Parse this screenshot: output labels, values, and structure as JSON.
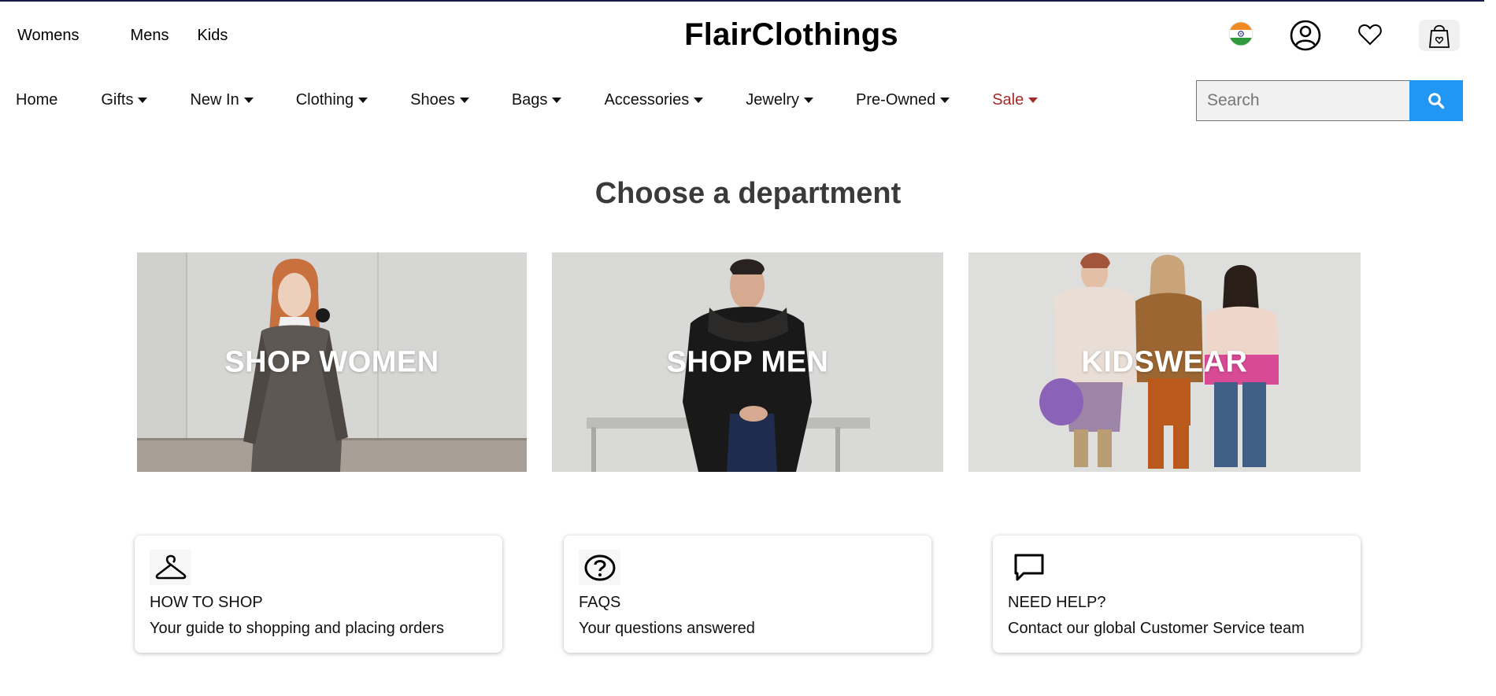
{
  "top_links": [
    "Womens",
    "Mens",
    "Kids"
  ],
  "brand": "FlairClothings",
  "header_icons": [
    "india-flag-icon",
    "account-icon",
    "wishlist-heart-icon",
    "shopping-bag-icon"
  ],
  "nav": {
    "items": [
      {
        "label": "Home",
        "dropdown": false
      },
      {
        "label": "Gifts",
        "dropdown": true
      },
      {
        "label": "New In",
        "dropdown": true
      },
      {
        "label": "Clothing",
        "dropdown": true
      },
      {
        "label": "Shoes",
        "dropdown": true
      },
      {
        "label": "Bags",
        "dropdown": true
      },
      {
        "label": "Accessories",
        "dropdown": true
      },
      {
        "label": "Jewelry",
        "dropdown": true
      },
      {
        "label": "Pre-Owned",
        "dropdown": true
      },
      {
        "label": "Sale",
        "dropdown": true
      }
    ],
    "sale_color": "#a52a2a"
  },
  "search": {
    "placeholder": "Search",
    "value": "",
    "button_color": "#2196f3"
  },
  "heading": "Choose a department",
  "departments": [
    {
      "label": "SHOP WOMEN"
    },
    {
      "label": "SHOP MEN"
    },
    {
      "label": "KIDSWEAR"
    }
  ],
  "info_cards": [
    {
      "icon": "hanger-icon",
      "title": "HOW TO SHOP",
      "desc": "Your guide to shopping and placing orders"
    },
    {
      "icon": "question-icon",
      "title": "FAQS",
      "desc": "Your questions answered"
    },
    {
      "icon": "chat-bubble-icon",
      "title": "NEED HELP?",
      "desc": "Contact our global Customer Service team"
    }
  ]
}
